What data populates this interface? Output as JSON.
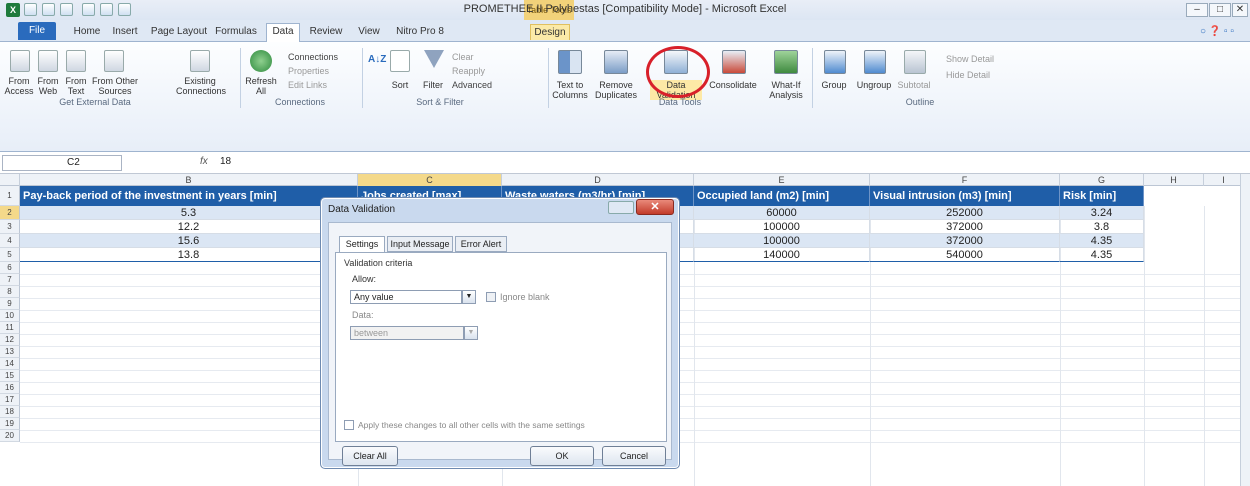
{
  "window": {
    "title": "PROMETHEE II Polyhestas [Compatibility Mode] - Microsoft Excel",
    "contextual_tag": "Table Tools",
    "controls": [
      "–",
      "□",
      "✕"
    ]
  },
  "tabs": {
    "file": "File",
    "items": [
      "Home",
      "Insert",
      "Page Layout",
      "Formulas",
      "Data",
      "Review",
      "View",
      "Nitro Pro 8",
      "Design"
    ]
  },
  "ribbon": {
    "get_external": {
      "buttons": [
        "From Access",
        "From Web",
        "From Text",
        "From Other Sources",
        "Existing Connections"
      ],
      "label": "Get External Data"
    },
    "connections": {
      "refresh": "Refresh All",
      "items": [
        "Connections",
        "Properties",
        "Edit Links"
      ],
      "label": "Connections"
    },
    "sort_filter": {
      "sort": "Sort",
      "filter": "Filter",
      "items": [
        "Clear",
        "Reapply",
        "Advanced"
      ],
      "label": "Sort & Filter"
    },
    "data_tools": {
      "buttons": [
        "Text to Columns",
        "Remove Duplicates",
        "Data Validation",
        "Consolidate",
        "What-If Analysis"
      ],
      "label": "Data Tools"
    },
    "outline": {
      "buttons": [
        "Group",
        "Ungroup",
        "Subtotal"
      ],
      "items": [
        "Show Detail",
        "Hide Detail"
      ],
      "label": "Outline"
    }
  },
  "formula_bar": {
    "name_box": "C2",
    "fx": "fx",
    "value": "18"
  },
  "columns": [
    "B",
    "C",
    "D",
    "E",
    "F",
    "G",
    "H",
    "I"
  ],
  "rows": [
    "1",
    "2",
    "3",
    "4",
    "5",
    "6",
    "7",
    "8",
    "9",
    "10",
    "11",
    "12",
    "13",
    "14",
    "15",
    "16",
    "17",
    "18",
    "19",
    "20"
  ],
  "table": {
    "headers": [
      "Pay-back period of the investment in years [min]",
      "Jobs created [max]",
      "Waste waters (m3/hr) [min]",
      "Occupied land (m2) [min]",
      "Visual intrusion (m3) [min]",
      "Risk [min]"
    ],
    "rows": [
      [
        "5.3",
        "",
        "",
        "60000",
        "252000",
        "3.24"
      ],
      [
        "12.2",
        "",
        "",
        "100000",
        "372000",
        "3.8"
      ],
      [
        "15.6",
        "",
        "",
        "100000",
        "372000",
        "4.35"
      ],
      [
        "13.8",
        "",
        "",
        "140000",
        "540000",
        "4.35"
      ]
    ]
  },
  "dialog": {
    "title": "Data Validation",
    "tabs": [
      "Settings",
      "Input Message",
      "Error Alert"
    ],
    "criteria_label": "Validation criteria",
    "allow_label": "Allow:",
    "allow_value": "Any value",
    "ignore_blank": "Ignore blank",
    "data_label": "Data:",
    "data_value": "between",
    "apply_all": "Apply these changes to all other cells with the same settings",
    "clear_all": "Clear All",
    "ok": "OK",
    "cancel": "Cancel"
  }
}
